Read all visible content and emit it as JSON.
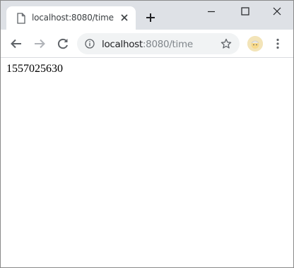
{
  "tab": {
    "title": "localhost:8080/time",
    "favicon_icon": "document-icon",
    "close_icon": "close-icon"
  },
  "new_tab_icon": "plus-icon",
  "window_controls": [
    "minimize-icon",
    "maximize-icon",
    "close-icon"
  ],
  "toolbar": {
    "back_icon": "back-arrow-icon",
    "forward_icon": "forward-arrow-icon",
    "reload_icon": "reload-icon"
  },
  "omnibox": {
    "security_icon": "info-icon",
    "url_host": "localhost",
    "url_rest": ":8080/time",
    "bookmark_icon": "star-icon"
  },
  "profile_icon": "avatar",
  "menu_icon": "kebab-menu-icon",
  "page": {
    "text": "1557025630"
  },
  "colors": {
    "tabstrip_bg": "#dee1e6",
    "omnibox_bg": "#f1f3f4",
    "icon": "#5f6368",
    "url_dim": "#80868b"
  }
}
